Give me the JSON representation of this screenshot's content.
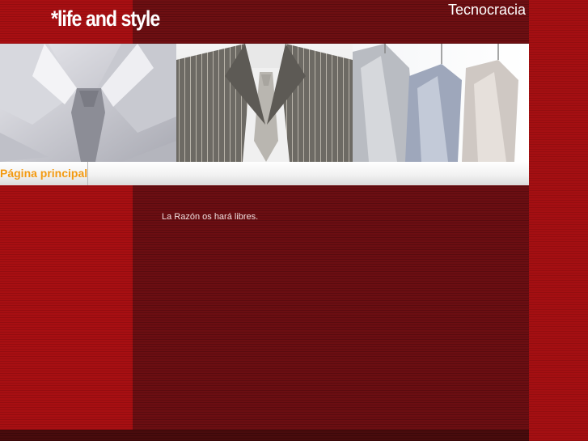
{
  "header": {
    "logo_text": "*life and style",
    "site_title": "Tecnocracia"
  },
  "banner": {
    "panels": [
      {
        "subject": "shirt-and-tie-photo"
      },
      {
        "subject": "pinstripe-suit-photo"
      },
      {
        "subject": "hanging-jackets-photo"
      }
    ]
  },
  "nav": {
    "items": [
      {
        "label": "Página principal"
      }
    ]
  },
  "main": {
    "text": "La Razón os hará libres."
  },
  "colors": {
    "page_red": "#a50f12",
    "main_dark_red": "#6c0e12",
    "nav_text_orange": "#f39a11"
  }
}
